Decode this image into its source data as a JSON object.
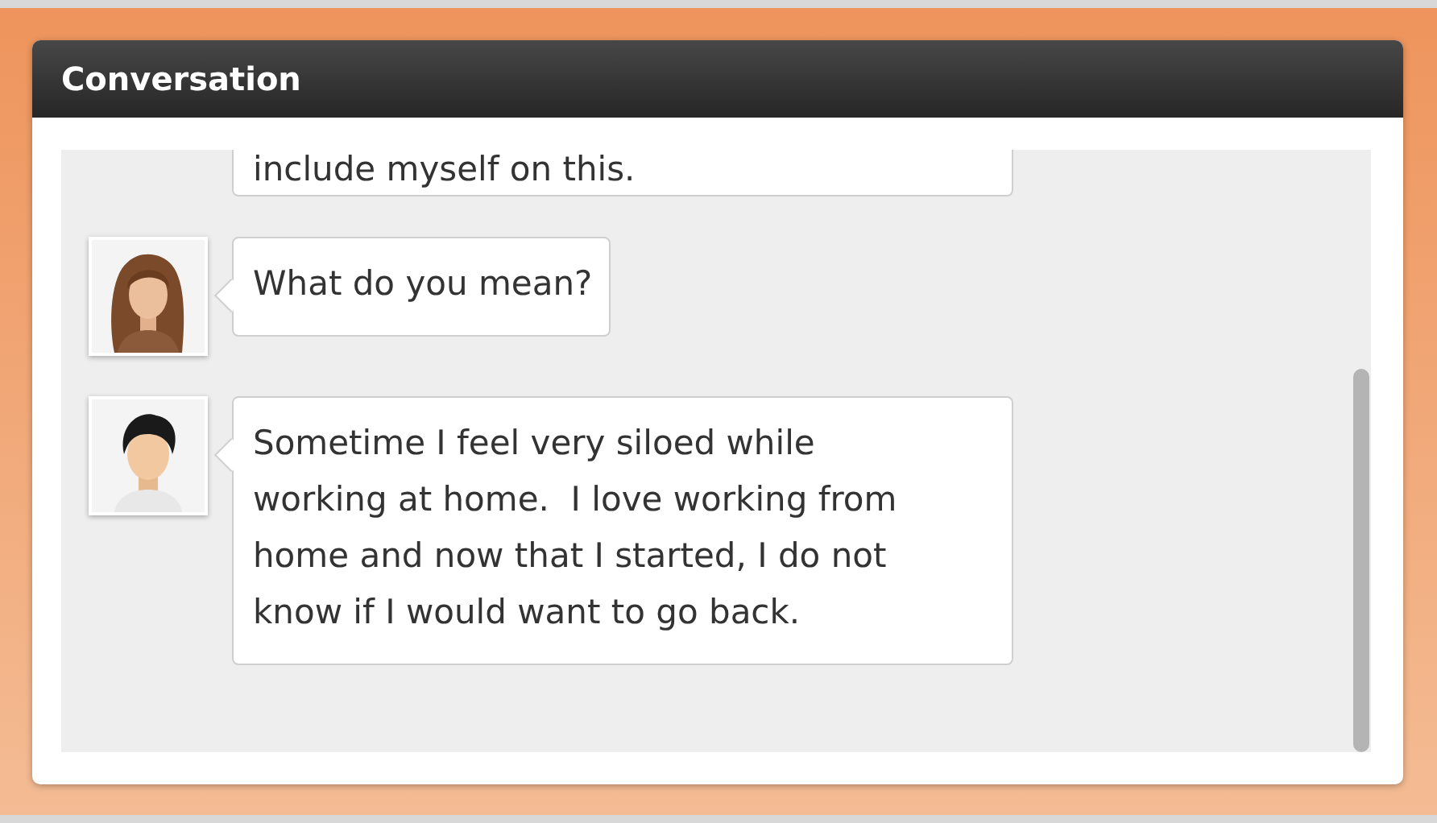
{
  "window": {
    "title": "Conversation"
  },
  "messages": [
    {
      "kind": "plain",
      "text": "include myself on this."
    },
    {
      "kind": "woman",
      "text": "What do you mean?"
    },
    {
      "kind": "man",
      "text": "Sometime I feel very siloed while working at home.  I love working from home and now that I started, I do not know if I would want to go back."
    }
  ]
}
